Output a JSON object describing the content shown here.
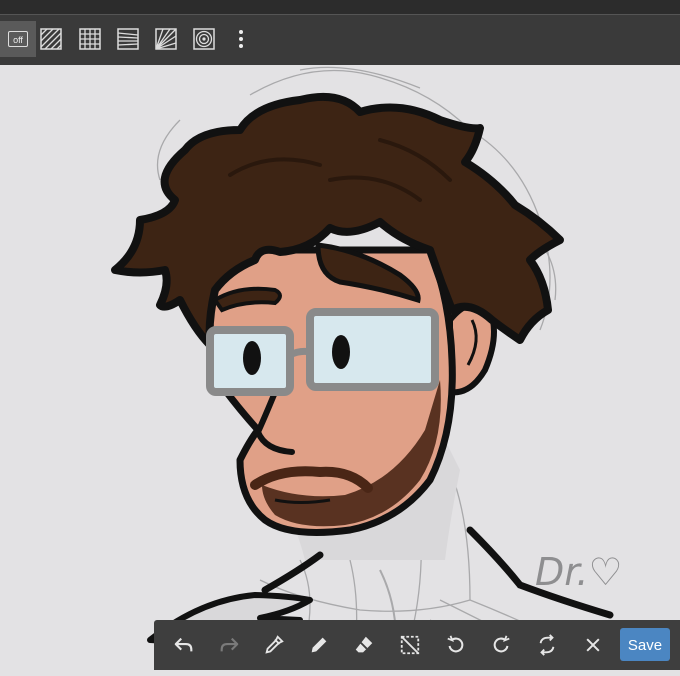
{
  "toolbar": {
    "buttons": [
      {
        "icon": "grid-off-icon",
        "label": "off",
        "active": true
      },
      {
        "icon": "diagonal-lines-icon"
      },
      {
        "icon": "square-grid-icon"
      },
      {
        "icon": "perspective-lines-icon"
      },
      {
        "icon": "radial-lines-icon"
      },
      {
        "icon": "concentric-circles-icon"
      },
      {
        "icon": "more-vert-icon"
      }
    ]
  },
  "canvas": {
    "signature": "Dr.♡"
  },
  "bottom_bar": {
    "tools": [
      {
        "icon": "undo-icon"
      },
      {
        "icon": "redo-icon",
        "disabled": true
      },
      {
        "icon": "eyedropper-icon"
      },
      {
        "icon": "pencil-icon"
      },
      {
        "icon": "eraser-icon"
      },
      {
        "icon": "selection-icon"
      },
      {
        "icon": "rotate-left-icon"
      },
      {
        "icon": "rotate-right-icon"
      },
      {
        "icon": "flip-icon"
      },
      {
        "icon": "close-icon"
      }
    ],
    "save_label": "Save"
  },
  "colors": {
    "toolbar_bg": "#3a3a3a",
    "paper": "#e3e2e4",
    "hair": "#3d2414",
    "skin": "#e0a087",
    "beard": "#4a2616",
    "glasses_frame": "#8a8a8a",
    "lens": "#d7e8ee",
    "save_button": "#4b86c2"
  }
}
